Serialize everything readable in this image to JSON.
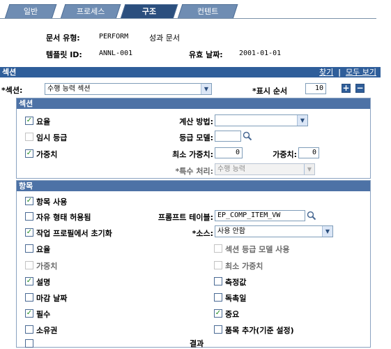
{
  "tabs": [
    {
      "label": "일반"
    },
    {
      "label": "프로세스"
    },
    {
      "label": "구조"
    },
    {
      "label": "컨텐트"
    }
  ],
  "header": {
    "doc_type_label": "문서 유형:",
    "doc_type_code": "PERFORM",
    "doc_type_desc": "성과 문서",
    "template_id_label": "템플릿 ID:",
    "template_id_value": "ANNL-001",
    "effective_date_label": "유효 날짜:",
    "effective_date_value": "2001-01-01"
  },
  "section_grid": {
    "title": "섹션",
    "find_link": "찾기",
    "separator": "|",
    "view_all_link": "모두 보기",
    "section_label": "*섹션:",
    "section_value": "수행 능력 섹션",
    "display_order_label": "*표시 순서",
    "display_order_value": "10",
    "add_button": "+",
    "remove_button": "−"
  },
  "section_panel": {
    "title": "섹션",
    "rating_checkbox": {
      "label": "요율",
      "checked": true
    },
    "calc_method_label": "계산 방법:",
    "calc_method_value": "",
    "temp_rating_checkbox": {
      "label": "임시 등급",
      "checked": false
    },
    "rating_model_label": "등급 모델:",
    "rating_model_value": "",
    "weight_checkbox": {
      "label": "가중치",
      "checked": true
    },
    "min_weight_label": "최소 가중치:",
    "min_weight_value": "0",
    "weight_label": "가중치:",
    "weight_value": "0",
    "special_handling_label": "*특수 처리:",
    "special_handling_value": "수행 능력"
  },
  "items_panel": {
    "title": "항목",
    "use_items": {
      "label": "항목 사용",
      "checked": true
    },
    "free_form": {
      "label": "자유 형태 허용됨",
      "checked": false
    },
    "prompt_table_label": "프롬프트 테이블:",
    "prompt_table_value": "EP_COMP_ITEM_VW",
    "init_from_profile": {
      "label": "작업 프로필에서 초기화",
      "checked": true
    },
    "source_label": "*소스:",
    "source_value": "사용 안함",
    "left_checks": [
      {
        "label": "요율",
        "checked": false,
        "disabled": false
      },
      {
        "label": "가중치",
        "checked": false,
        "disabled": true
      },
      {
        "label": "설명",
        "checked": true,
        "disabled": false
      },
      {
        "label": "마감 날짜",
        "checked": false,
        "disabled": false
      },
      {
        "label": "필수",
        "checked": true,
        "disabled": false
      },
      {
        "label": "소유권",
        "checked": false,
        "disabled": false
      }
    ],
    "right_checks": [
      {
        "label": "섹션 등급 모델 사용",
        "checked": false,
        "disabled": true
      },
      {
        "label": "최소 가중치",
        "checked": false,
        "disabled": true
      },
      {
        "label": "측정값",
        "checked": false,
        "disabled": false
      },
      {
        "label": "독촉일",
        "checked": false,
        "disabled": false
      },
      {
        "label": "중요",
        "checked": true,
        "disabled": false
      },
      {
        "label": "품목 추가(기준 설정)",
        "checked": false,
        "disabled": false
      }
    ],
    "cutoff_label": "결과"
  },
  "colors": {
    "tab": "#6f8db3",
    "tab_active": "#2b4f7e",
    "bar": "#2f5e9a",
    "bar_light": "#4d72a6",
    "check": "#1f8a1f"
  },
  "icons": {
    "lookup": "magnifier-icon",
    "dropdown": "chevron-down-icon",
    "add": "plus-icon",
    "remove": "minus-icon"
  }
}
